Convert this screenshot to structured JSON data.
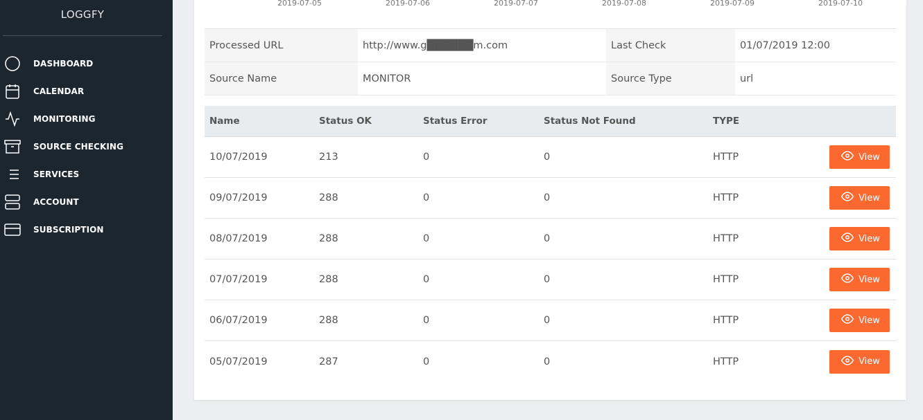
{
  "sidebar": {
    "brand": "LOGGFY",
    "items": [
      {
        "label": "DASHBOARD",
        "icon": "circle-icon"
      },
      {
        "label": "CALENDAR",
        "icon": "calendar-icon"
      },
      {
        "label": "MONITORING",
        "icon": "activity-icon"
      },
      {
        "label": "SOURCE CHECKING",
        "icon": "archive-icon"
      },
      {
        "label": "SERVICES",
        "icon": "list-icon"
      },
      {
        "label": "ACCOUNT",
        "icon": "server-icon"
      },
      {
        "label": "SUBSCRIPTION",
        "icon": "credit-card-icon"
      }
    ]
  },
  "chart_axis_dates": [
    "2019-07-05",
    "2019-07-06",
    "2019-07-07",
    "2019-07-08",
    "2019-07-09",
    "2019-07-10"
  ],
  "info": {
    "processed_url_label": "Processed URL",
    "processed_url_value": "http://www.g██████m.com",
    "last_check_label": "Last Check",
    "last_check_value": "01/07/2019 12:00",
    "source_name_label": "Source Name",
    "source_name_value": "MONITOR",
    "source_type_label": "Source Type",
    "source_type_value": "url"
  },
  "table": {
    "headers": [
      "Name",
      "Status OK",
      "Status Error",
      "Status Not Found",
      "TYPE"
    ],
    "view_label": "View",
    "rows": [
      [
        "10/07/2019",
        "213",
        "0",
        "0",
        "HTTP"
      ],
      [
        "09/07/2019",
        "288",
        "0",
        "0",
        "HTTP"
      ],
      [
        "08/07/2019",
        "288",
        "0",
        "0",
        "HTTP"
      ],
      [
        "07/07/2019",
        "288",
        "0",
        "0",
        "HTTP"
      ],
      [
        "06/07/2019",
        "288",
        "0",
        "0",
        "HTTP"
      ],
      [
        "05/07/2019",
        "287",
        "0",
        "0",
        "HTTP"
      ]
    ]
  },
  "colors": {
    "sidebar_bg": "#1b262f",
    "accent": "#fb6931",
    "header_bg": "#e9ecef"
  }
}
